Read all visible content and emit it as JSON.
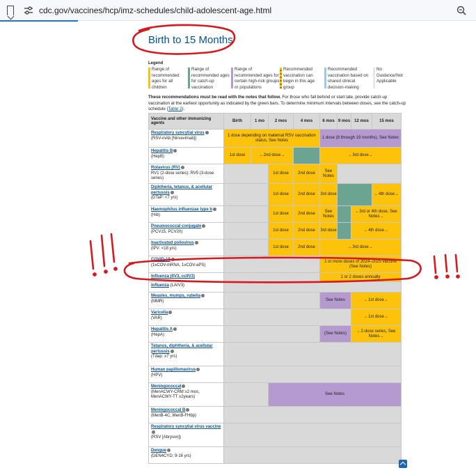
{
  "browser": {
    "url": "cdc.gov/vaccines/hcp/imz-schedules/child-adolescent-age.html"
  },
  "page": {
    "title": "Birth to 15 Months"
  },
  "legend": {
    "title": "Legend",
    "items": [
      {
        "text": "Range of recommended ages for all children",
        "color": "#fdc20a"
      },
      {
        "text": "Range of recommended ages for catch-up vaccination",
        "color": "#6ba592"
      },
      {
        "text": "Range of recommended ages for certain high-risk groups or populations",
        "color": "#b59ad0"
      },
      {
        "text": "Recommended vaccination can begin in this age group",
        "color": "#fdc20a"
      },
      {
        "text": "Recommended vaccination based on shared clinical decision-making",
        "color": "#9ec9e8"
      },
      {
        "text": "No Guidance/Not Applicable",
        "color": "#ffffff"
      }
    ]
  },
  "notes": {
    "bold": "These recommendations must be read with the notes that follow.",
    "rest": " For those who fall behind or start late, provide catch-up vaccination at the earliest opportunity as indicated by the green bars. To determine minimum intervals between doses, see the catch-up schedule (",
    "link": "Table 2",
    "end": ")."
  },
  "table": {
    "header_first": "Vaccine and other immunizing agents",
    "ages": [
      "Birth",
      "1 mo",
      "2 mos",
      "4 mos",
      "6 mos",
      "9 mos",
      "12 mos",
      "15 mos"
    ],
    "rows": [
      {
        "name": "Respiratory syncytial virus",
        "sub": "(RSV-mAb [Nirsevimab])"
      },
      {
        "name": "Hepatitis B",
        "sub": "(HepB)"
      },
      {
        "name": "Rotavirus (RV)",
        "sub": "RV1 (2-dose series); RV5 (3-dose series)"
      },
      {
        "name": "Diphtheria, tetanus, & acellular pertussis",
        "sub": "(DTaP: <7 yrs)"
      },
      {
        "name": "Haemophilus influenzae type b",
        "sub": "(Hib)"
      },
      {
        "name": "Pneumococcal conjugate",
        "sub": "(PCV15, PCV20)"
      },
      {
        "name": "Inactivated poliovirus",
        "sub": "(IPV: <18 yrs)"
      },
      {
        "name": "COVID-19",
        "sub": "(1vCOV-mRNA, 1vCOV-aPS)"
      },
      {
        "name": "Influenza (IIV3, ccIIV3)",
        "sub": ""
      },
      {
        "name": "Influenza",
        "sub": "(LAIV3)"
      },
      {
        "name": "Measles, mumps, rubella",
        "sub": "(MMR)"
      },
      {
        "name": "Varicella",
        "sub": "(VAR)"
      },
      {
        "name": "Hepatitis A",
        "sub": "(HepA)"
      },
      {
        "name": "Tetanus, diphtheria, & acellular pertussis",
        "sub": "(Tdap: ≥7 yrs)"
      },
      {
        "name": "Human papillomavirus",
        "sub": "(HPV)"
      },
      {
        "name": "Meningococcal",
        "sub": "(MenACWY-CRM ≥2 mos, MenACWY-TT ≥2years)"
      },
      {
        "name": "Meningococcal B",
        "sub": "(MenB-4C, MenB-FHbp)"
      },
      {
        "name": "Respiratory syncytial virus vaccine",
        "sub": "(RSV [Abrysvo])"
      },
      {
        "name": "Dengue",
        "sub": "(DEN4CYD; 9-16 yrs)"
      }
    ],
    "cells": {
      "rsv_mab_1": "1 dose depending on maternal RSV vaccination status, See Notes",
      "rsv_mab_2": "1 dose (8 through 19 months), See Notes",
      "dose1": "1st dose",
      "dose2": "2nd dose",
      "dose3": "3rd dose",
      "dose2_arrow": "←2nd dose→",
      "dose3_arrow": "←3rd dose→",
      "dose4_arrow": "←4th dose→",
      "see_notes": "See Notes",
      "hib_34": "←3rd or 4th dose, See Notes→",
      "covid": "1 or more doses of 2024–2025 vaccine (See Notes)",
      "flu": "1 or 2 doses annually",
      "dose1_arrow": "←1st dose→",
      "hepa_see": "(See Notes)",
      "hepa_series": "←2-dose series, See Notes→"
    }
  },
  "annotations": {
    "color": "#d8181e",
    "exclaim_left": "!!!",
    "exclaim_right": "!!!"
  }
}
